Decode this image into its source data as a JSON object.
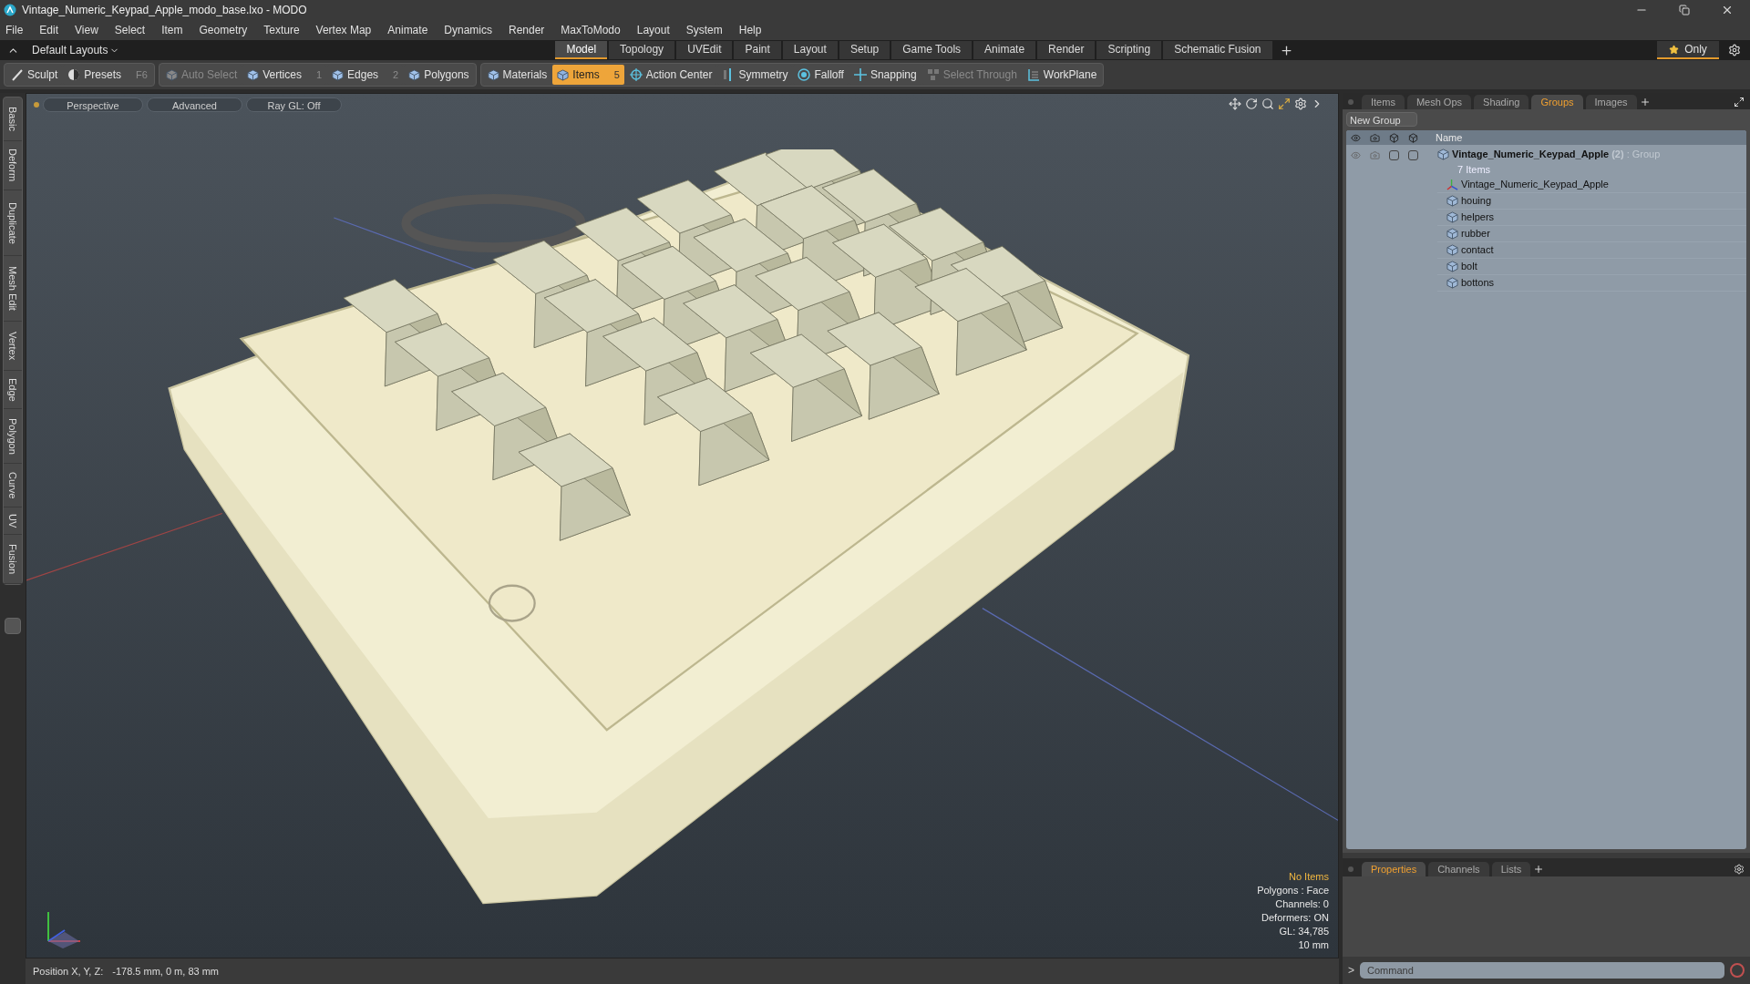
{
  "window": {
    "title": "Vintage_Numeric_Keypad_Apple_modo_base.lxo - MODO"
  },
  "menu": [
    "File",
    "Edit",
    "View",
    "Select",
    "Item",
    "Geometry",
    "Texture",
    "Vertex Map",
    "Animate",
    "Dynamics",
    "Render",
    "MaxToModo",
    "Layout",
    "System",
    "Help"
  ],
  "layout_bar": {
    "layouts_dropdown": "Default Layouts",
    "only_button": "Only",
    "tabs": [
      {
        "label": "Model",
        "selected": true
      },
      {
        "label": "Topology",
        "selected": false
      },
      {
        "label": "UVEdit",
        "selected": false
      },
      {
        "label": "Paint",
        "selected": false
      },
      {
        "label": "Layout",
        "selected": false
      },
      {
        "label": "Setup",
        "selected": false
      },
      {
        "label": "Game Tools",
        "selected": false
      },
      {
        "label": "Animate",
        "selected": false
      },
      {
        "label": "Render",
        "selected": false
      },
      {
        "label": "Scripting",
        "selected": false
      },
      {
        "label": "Schematic Fusion",
        "selected": false
      }
    ]
  },
  "toolbar": [
    [
      {
        "label": "Sculpt",
        "disabled": false,
        "selected": false
      },
      {
        "label": "Presets",
        "shortcut": "F6",
        "disabled": false,
        "selected": false
      }
    ],
    [
      {
        "label": "Auto Select",
        "disabled": true,
        "selected": false
      },
      {
        "label": "Vertices",
        "shortcut": "1",
        "disabled": false,
        "selected": false
      },
      {
        "label": "Edges",
        "shortcut": "2",
        "disabled": false,
        "selected": false
      },
      {
        "label": "Polygons",
        "disabled": false,
        "selected": false
      }
    ],
    [
      {
        "label": "Materials",
        "disabled": false,
        "selected": false
      },
      {
        "label": "Items",
        "shortcut": "5",
        "disabled": false,
        "selected": true
      },
      {
        "label": "Action Center",
        "disabled": false,
        "selected": false
      },
      {
        "label": "Symmetry",
        "disabled": false,
        "selected": false
      },
      {
        "label": "Falloff",
        "disabled": false,
        "selected": false
      },
      {
        "label": "Snapping",
        "disabled": false,
        "selected": false
      },
      {
        "label": "Select Through",
        "disabled": true,
        "selected": false
      },
      {
        "label": "WorkPlane",
        "disabled": false,
        "selected": false
      }
    ]
  ],
  "left_tabs": [
    "Basic",
    "Deform",
    "Duplicate",
    "Mesh Edit",
    "Vertex",
    "Edge",
    "Polygon",
    "Curve",
    "UV",
    "Fusion"
  ],
  "viewport": {
    "buttons": [
      "Perspective",
      "Advanced",
      "Ray GL: Off"
    ],
    "info": {
      "selection": "No Items",
      "lines": [
        "Polygons : Face",
        "Channels: 0",
        "Deformers: ON",
        "GL: 34,785",
        "10 mm"
      ]
    }
  },
  "groups_panel": {
    "tabs": [
      {
        "label": "Items",
        "selected": false
      },
      {
        "label": "Mesh Ops",
        "selected": false
      },
      {
        "label": "Shading",
        "selected": false
      },
      {
        "label": "Groups",
        "selected": true
      },
      {
        "label": "Images",
        "selected": false
      }
    ],
    "new_group_button": "New Group",
    "name_column": "Name",
    "group": {
      "toggles": [
        {
          "on": false
        },
        {
          "on": false
        }
      ],
      "name": "Vintage_Numeric_Keypad_Apple",
      "count": "(2)",
      "type": ": Group",
      "subtitle": "7 Items",
      "children": [
        {
          "name": "Vintage_Numeric_Keypad_Apple",
          "kind": "locator"
        },
        {
          "name": "houing",
          "kind": "mesh"
        },
        {
          "name": "helpers",
          "kind": "mesh"
        },
        {
          "name": "rubber",
          "kind": "mesh"
        },
        {
          "name": "contact",
          "kind": "mesh"
        },
        {
          "name": "bolt",
          "kind": "mesh"
        },
        {
          "name": "bottons",
          "kind": "mesh"
        }
      ]
    }
  },
  "properties_panel": {
    "tabs": [
      {
        "label": "Properties",
        "selected": true
      },
      {
        "label": "Channels",
        "selected": false
      },
      {
        "label": "Lists",
        "selected": false
      }
    ],
    "prompt": ">",
    "command": {
      "placeholder": "Command"
    }
  },
  "status_bar": {
    "label": "Position X, Y, Z:",
    "value": "-178.5 mm, 0 m, 83 mm"
  }
}
